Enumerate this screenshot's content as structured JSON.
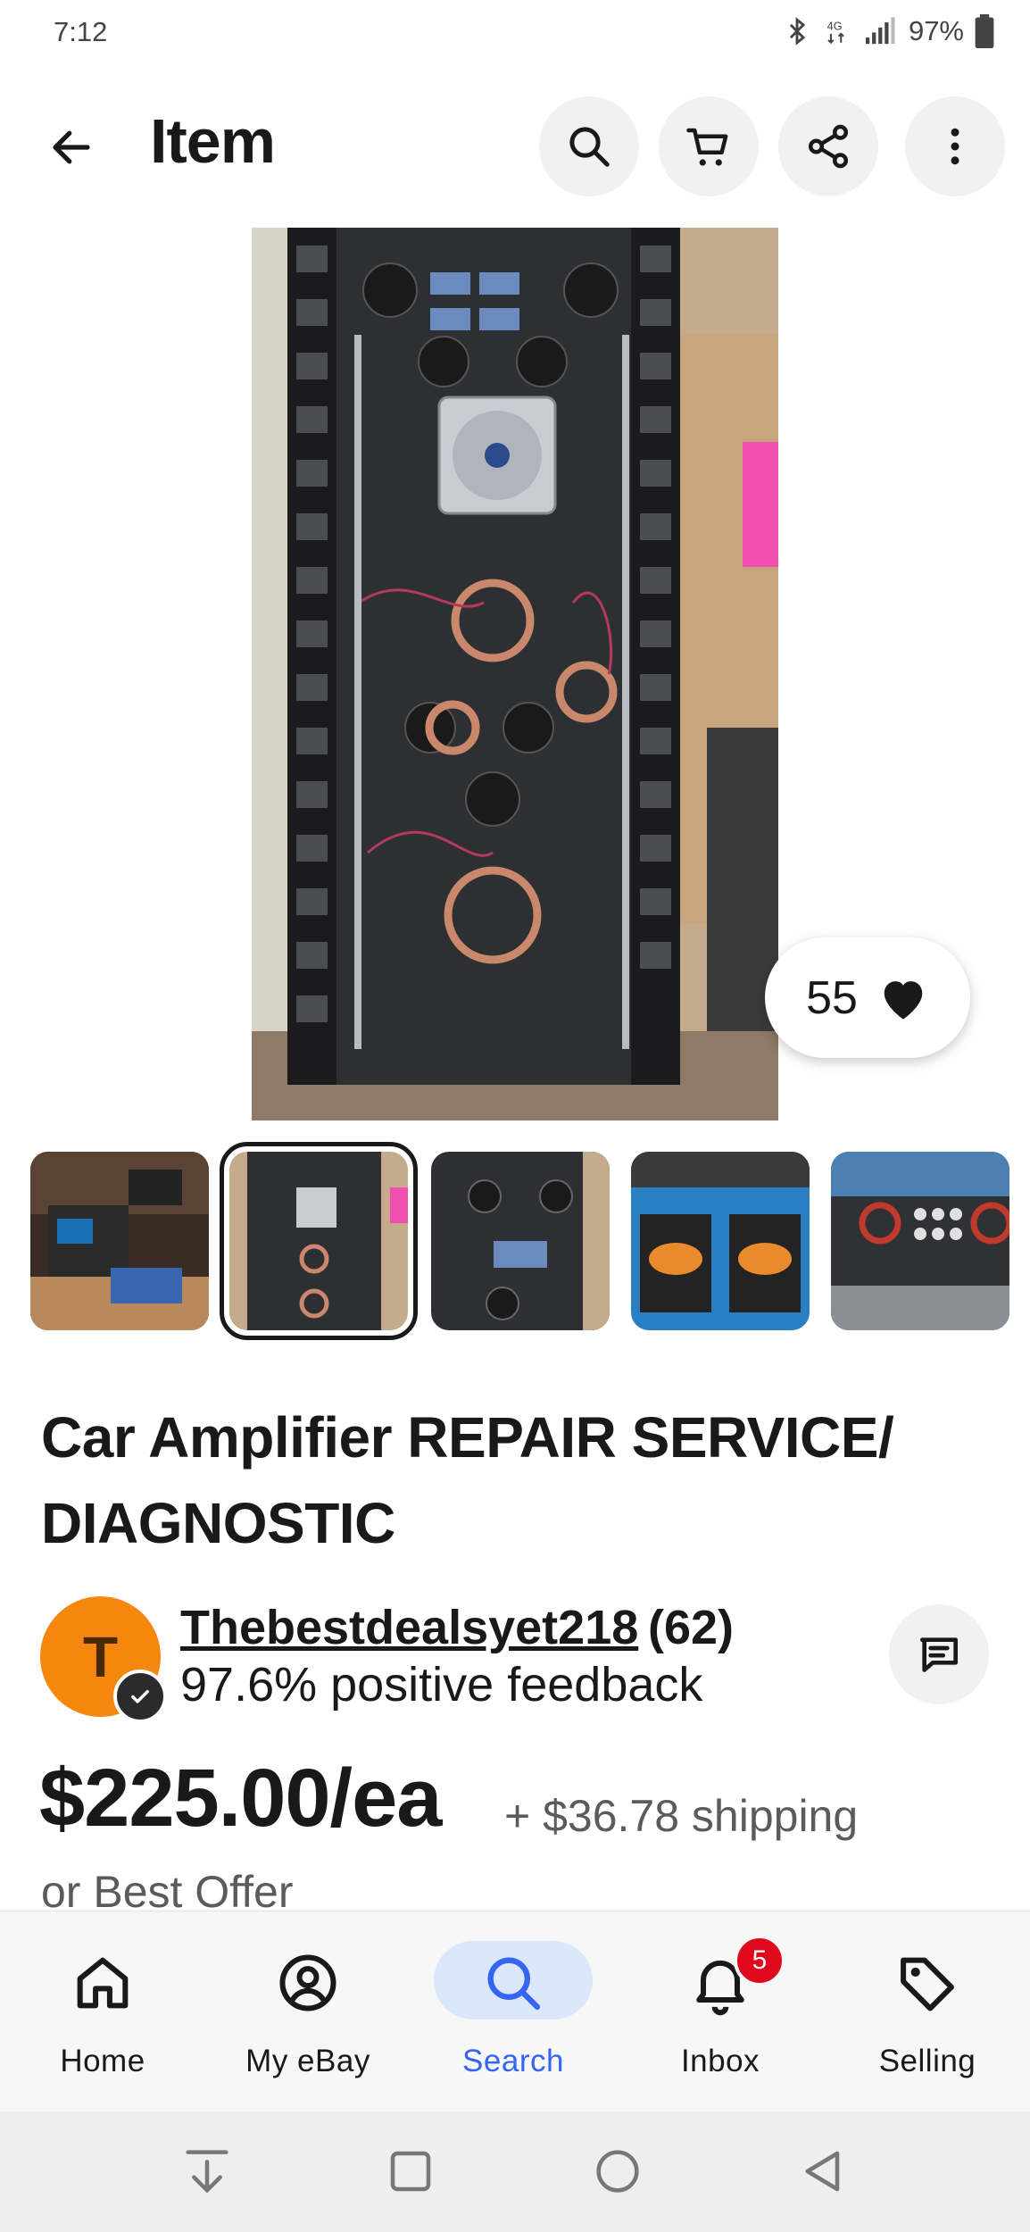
{
  "status_bar": {
    "time": "7:12",
    "network": "4G LTE",
    "battery": "97%"
  },
  "header": {
    "title": "Item",
    "icons": [
      "back-arrow-icon",
      "search-icon",
      "cart-icon",
      "share-icon",
      "more-vertical-icon"
    ]
  },
  "gallery": {
    "like_count": "55",
    "thumbnail_count": 5,
    "selected_thumbnail": 2
  },
  "item": {
    "title": "Car Amplifier REPAIR SERVICE/ DIAGNOSTIC"
  },
  "seller": {
    "avatar_letter": "T",
    "name": "Thebestdealsyet218",
    "feedback_count": "(62)",
    "feedback_text": "97.6% positive feedback"
  },
  "pricing": {
    "price": "$225.00/ea",
    "shipping": "+ $36.78 shipping",
    "best_offer": "or Best Offer"
  },
  "bottom_nav": {
    "items": [
      {
        "label": "Home",
        "icon": "home-icon"
      },
      {
        "label": "My eBay",
        "icon": "user-circle-icon"
      },
      {
        "label": "Search",
        "icon": "search-icon"
      },
      {
        "label": "Inbox",
        "icon": "bell-icon",
        "badge": "5"
      },
      {
        "label": "Selling",
        "icon": "tag-icon"
      }
    ],
    "active": "Search"
  },
  "colors": {
    "accent": "#3665f3",
    "active_pill": "#dbe7fb",
    "badge": "#e0081d",
    "avatar": "#f5870f"
  }
}
